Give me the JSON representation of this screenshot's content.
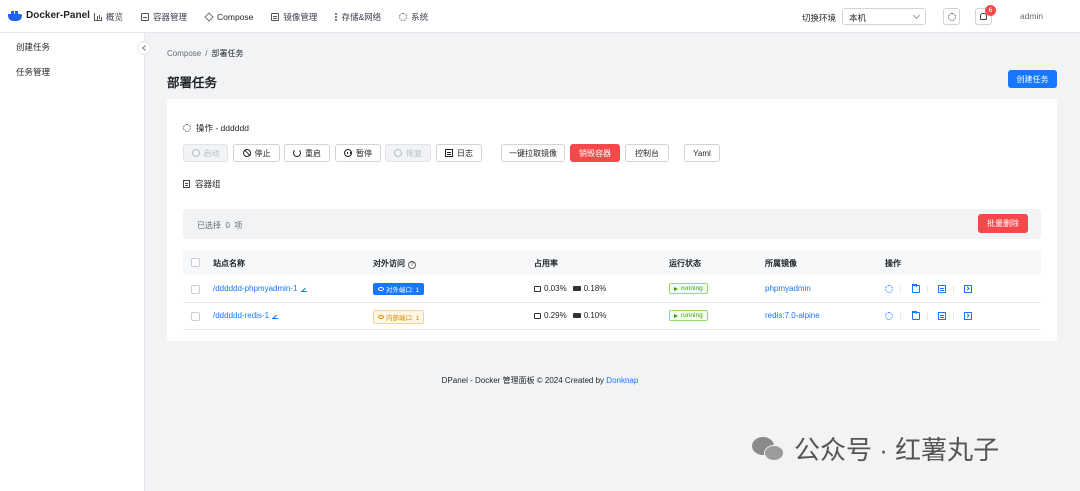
{
  "app": {
    "name": "Docker-Panel"
  },
  "nav": [
    {
      "label": "概览",
      "icon": "chart-icon"
    },
    {
      "label": "容器管理",
      "icon": "container-icon"
    },
    {
      "label": "Compose",
      "icon": "cube-icon"
    },
    {
      "label": "镜像管理",
      "icon": "image-icon"
    },
    {
      "label": "存储&网络",
      "icon": "more-icon"
    },
    {
      "label": "系统",
      "icon": "gear-icon"
    }
  ],
  "header": {
    "env_label": "切换环境",
    "env_value": "本机",
    "notification_count": "6",
    "user": "admin"
  },
  "sidebar": {
    "items": [
      {
        "label": "创建任务"
      },
      {
        "label": "任务管理"
      }
    ]
  },
  "breadcrumb": {
    "parent": "Compose",
    "sep": "/",
    "current": "部署任务"
  },
  "page": {
    "title": "部署任务",
    "create_button": "创建任务"
  },
  "operations": {
    "label": "操作 - dddddd",
    "buttons": {
      "start": "启动",
      "stop": "停止",
      "restart": "重启",
      "pause": "暂停",
      "resume": "恢复",
      "logs": "日志",
      "pull": "一键拉取镜像",
      "destroy": "销毁容器",
      "console": "控制台",
      "yaml": "Yaml"
    }
  },
  "containers": {
    "label": "容器组",
    "selected_prefix": "已选择",
    "selected_count": "0",
    "selected_suffix": "项",
    "batch_delete": "批量删除",
    "columns": {
      "name": "站点名称",
      "access": "对外访问",
      "usage": "占用率",
      "status": "运行状态",
      "image": "所属镜像",
      "actions": "操作"
    },
    "rows": [
      {
        "name": "/dddddd-phpmyadmin-1",
        "access": "对外端口: 1",
        "access_type": "external",
        "cpu": "0.03%",
        "mem": "0.18%",
        "status": "running",
        "image": "phpmyadmin"
      },
      {
        "name": "/dddddd-redis-1",
        "access": "内部端口: 1",
        "access_type": "internal",
        "cpu": "0.29%",
        "mem": "0.10%",
        "status": "running",
        "image": "redis:7.0-alpine"
      }
    ]
  },
  "footer": {
    "text": "DPanel - Docker 管理面板 © 2024 Created by",
    "link": "Donknap"
  },
  "watermark": {
    "text": "公众号 · 红薯丸子"
  },
  "colors": {
    "primary": "#1677ff",
    "danger": "#f5484b",
    "success": "#389e0d",
    "warning": "#d48806"
  }
}
